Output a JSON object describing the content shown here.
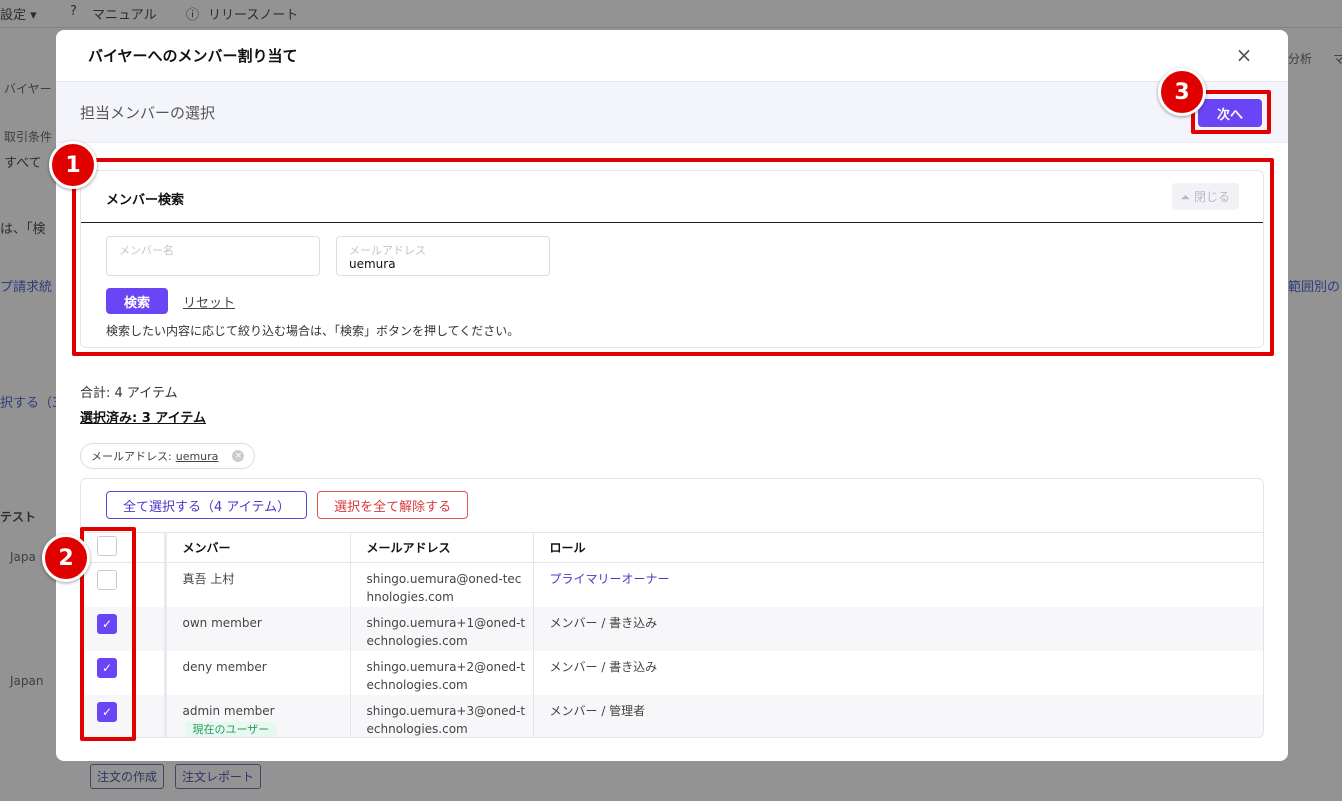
{
  "background": {
    "menu_settings": "設定 ▾",
    "menu_manual": "マニュアル",
    "menu_release": "リリースノート",
    "left_texts": [
      "バイヤー",
      "取引条件",
      "すべて",
      "は、「検",
      "プ請求統",
      "択する（3",
      "テスト",
      "Japa",
      "Japan"
    ],
    "right_texts": [
      "分析",
      "マ",
      "範囲別の"
    ],
    "bottom_buttons": [
      "注文の作成",
      "注文レポート"
    ]
  },
  "modal": {
    "title": "バイヤーへのメンバー割り当て",
    "close_symbol": "×",
    "subtitle": "担当メンバーの選択",
    "next_label": "次へ",
    "search": {
      "title": "メンバー検索",
      "close_label": "⏶ 閉じる",
      "member_name_label": "メンバー名",
      "member_name_value": "",
      "email_label": "メールアドレス",
      "email_value": "uemura",
      "search_label": "検索",
      "reset_label": "リセット",
      "hint": "検索したい内容に応じて絞り込む場合は、「検索」ボタンを押してください。"
    },
    "total": "合計:  4 アイテム",
    "selected": "選択済み:  3 アイテム",
    "filter_chip": {
      "label": "メールアドレス:",
      "value": "uemura",
      "remove": "×"
    },
    "select_all_label": "全て選択する（4 アイテム）",
    "deselect_all_label": "選択を全て解除する",
    "table": {
      "headers": {
        "member": "メンバー",
        "email": "メールアドレス",
        "role": "ロール"
      },
      "rows": [
        {
          "checked": false,
          "member": "真吾 上村",
          "email1": "shingo.uemura@oned-tec",
          "email2": "hnologies.com",
          "role": "プライマリーオーナー",
          "badge": ""
        },
        {
          "checked": true,
          "member": "own member",
          "email1": "shingo.uemura+1@oned-t",
          "email2": "echnologies.com",
          "role": "メンバー / 書き込み",
          "badge": ""
        },
        {
          "checked": true,
          "member": "deny member",
          "email1": "shingo.uemura+2@oned-t",
          "email2": "echnologies.com",
          "role": "メンバー / 書き込み",
          "badge": ""
        },
        {
          "checked": true,
          "member": "admin member",
          "email1": "shingo.uemura+3@oned-t",
          "email2": "echnologies.com",
          "role": "メンバー / 管理者",
          "badge": "現在のユーザー"
        }
      ]
    }
  },
  "annotations": [
    "1",
    "2",
    "3"
  ],
  "colors": {
    "accent": "#6a45f5",
    "annotation": "#e00000",
    "danger": "#d83a3a"
  }
}
